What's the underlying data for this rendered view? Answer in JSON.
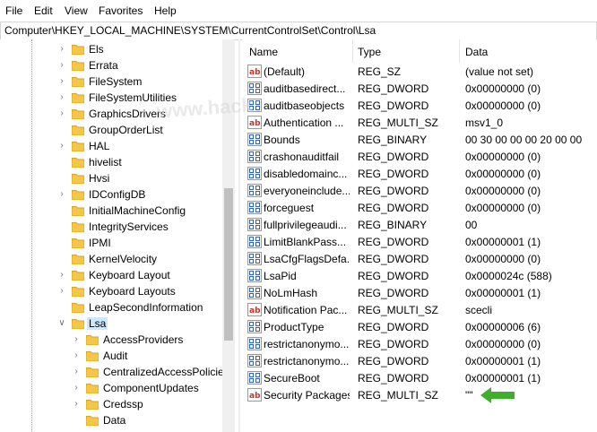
{
  "menu": [
    "File",
    "Edit",
    "View",
    "Favorites",
    "Help"
  ],
  "address": "Computer\\HKEY_LOCAL_MACHINE\\SYSTEM\\CurrentControlSet\\Control\\Lsa",
  "watermark": "www.hack",
  "tree": {
    "items": [
      {
        "label": "Els",
        "depth": 1,
        "expander": "collapsed"
      },
      {
        "label": "Errata",
        "depth": 1,
        "expander": "collapsed"
      },
      {
        "label": "FileSystem",
        "depth": 1,
        "expander": "collapsed"
      },
      {
        "label": "FileSystemUtilities",
        "depth": 1,
        "expander": "collapsed"
      },
      {
        "label": "GraphicsDrivers",
        "depth": 1,
        "expander": "collapsed"
      },
      {
        "label": "GroupOrderList",
        "depth": 1,
        "expander": "none"
      },
      {
        "label": "HAL",
        "depth": 1,
        "expander": "collapsed"
      },
      {
        "label": "hivelist",
        "depth": 1,
        "expander": "none"
      },
      {
        "label": "Hvsi",
        "depth": 1,
        "expander": "none"
      },
      {
        "label": "IDConfigDB",
        "depth": 1,
        "expander": "collapsed"
      },
      {
        "label": "InitialMachineConfig",
        "depth": 1,
        "expander": "none"
      },
      {
        "label": "IntegrityServices",
        "depth": 1,
        "expander": "none"
      },
      {
        "label": "IPMI",
        "depth": 1,
        "expander": "none"
      },
      {
        "label": "KernelVelocity",
        "depth": 1,
        "expander": "none"
      },
      {
        "label": "Keyboard Layout",
        "depth": 1,
        "expander": "collapsed"
      },
      {
        "label": "Keyboard Layouts",
        "depth": 1,
        "expander": "collapsed"
      },
      {
        "label": "LeapSecondInformation",
        "depth": 1,
        "expander": "none"
      },
      {
        "label": "Lsa",
        "depth": 1,
        "expander": "expanded",
        "selected": true
      },
      {
        "label": "AccessProviders",
        "depth": 2,
        "expander": "collapsed"
      },
      {
        "label": "Audit",
        "depth": 2,
        "expander": "collapsed"
      },
      {
        "label": "CentralizedAccessPolicies",
        "depth": 2,
        "expander": "collapsed"
      },
      {
        "label": "ComponentUpdates",
        "depth": 2,
        "expander": "collapsed"
      },
      {
        "label": "Credssp",
        "depth": 2,
        "expander": "collapsed"
      },
      {
        "label": "Data",
        "depth": 2,
        "expander": "none"
      }
    ]
  },
  "list": {
    "columns": {
      "name": "Name",
      "type": "Type",
      "data": "Data"
    },
    "rows": [
      {
        "name": "(Default)",
        "type": "REG_SZ",
        "data": "(value not set)",
        "icon": "string-value-icon"
      },
      {
        "name": "auditbasedirect...",
        "type": "REG_DWORD",
        "data": "0x00000000 (0)",
        "icon": "binary-value-icon"
      },
      {
        "name": "auditbaseobjects",
        "type": "REG_DWORD",
        "data": "0x00000000 (0)",
        "icon": "binary-value-icon"
      },
      {
        "name": "Authentication ...",
        "type": "REG_MULTI_SZ",
        "data": "msv1_0",
        "icon": "string-value-icon"
      },
      {
        "name": "Bounds",
        "type": "REG_BINARY",
        "data": "00 30 00 00 00 20 00 00",
        "icon": "binary-value-icon"
      },
      {
        "name": "crashonauditfail",
        "type": "REG_DWORD",
        "data": "0x00000000 (0)",
        "icon": "binary-value-icon"
      },
      {
        "name": "disabledomainc...",
        "type": "REG_DWORD",
        "data": "0x00000000 (0)",
        "icon": "binary-value-icon"
      },
      {
        "name": "everyoneinclude...",
        "type": "REG_DWORD",
        "data": "0x00000000 (0)",
        "icon": "binary-value-icon"
      },
      {
        "name": "forceguest",
        "type": "REG_DWORD",
        "data": "0x00000000 (0)",
        "icon": "binary-value-icon"
      },
      {
        "name": "fullprivilegeaudi...",
        "type": "REG_BINARY",
        "data": "00",
        "icon": "binary-value-icon"
      },
      {
        "name": "LimitBlankPass...",
        "type": "REG_DWORD",
        "data": "0x00000001 (1)",
        "icon": "binary-value-icon"
      },
      {
        "name": "LsaCfgFlagsDefa...",
        "type": "REG_DWORD",
        "data": "0x00000000 (0)",
        "icon": "binary-value-icon"
      },
      {
        "name": "LsaPid",
        "type": "REG_DWORD",
        "data": "0x0000024c (588)",
        "icon": "binary-value-icon"
      },
      {
        "name": "NoLmHash",
        "type": "REG_DWORD",
        "data": "0x00000001 (1)",
        "icon": "binary-value-icon"
      },
      {
        "name": "Notification Pac...",
        "type": "REG_MULTI_SZ",
        "data": "scecli",
        "icon": "string-value-icon"
      },
      {
        "name": "ProductType",
        "type": "REG_DWORD",
        "data": "0x00000006 (6)",
        "icon": "binary-value-icon"
      },
      {
        "name": "restrictanonymo...",
        "type": "REG_DWORD",
        "data": "0x00000000 (0)",
        "icon": "binary-value-icon"
      },
      {
        "name": "restrictanonymo...",
        "type": "REG_DWORD",
        "data": "0x00000001 (1)",
        "icon": "binary-value-icon"
      },
      {
        "name": "SecureBoot",
        "type": "REG_DWORD",
        "data": "0x00000001 (1)",
        "icon": "binary-value-icon"
      },
      {
        "name": "Security Packages",
        "type": "REG_MULTI_SZ",
        "data": "\"\"",
        "icon": "string-value-icon"
      }
    ]
  },
  "colors": {
    "folder": "#f5c748",
    "folder_edge": "#d9a521",
    "selection": "#cce8ff",
    "binary_icon": "#2a62c9",
    "string_icon": "#c8312b",
    "annotation_arrow": "#3fae2a"
  }
}
